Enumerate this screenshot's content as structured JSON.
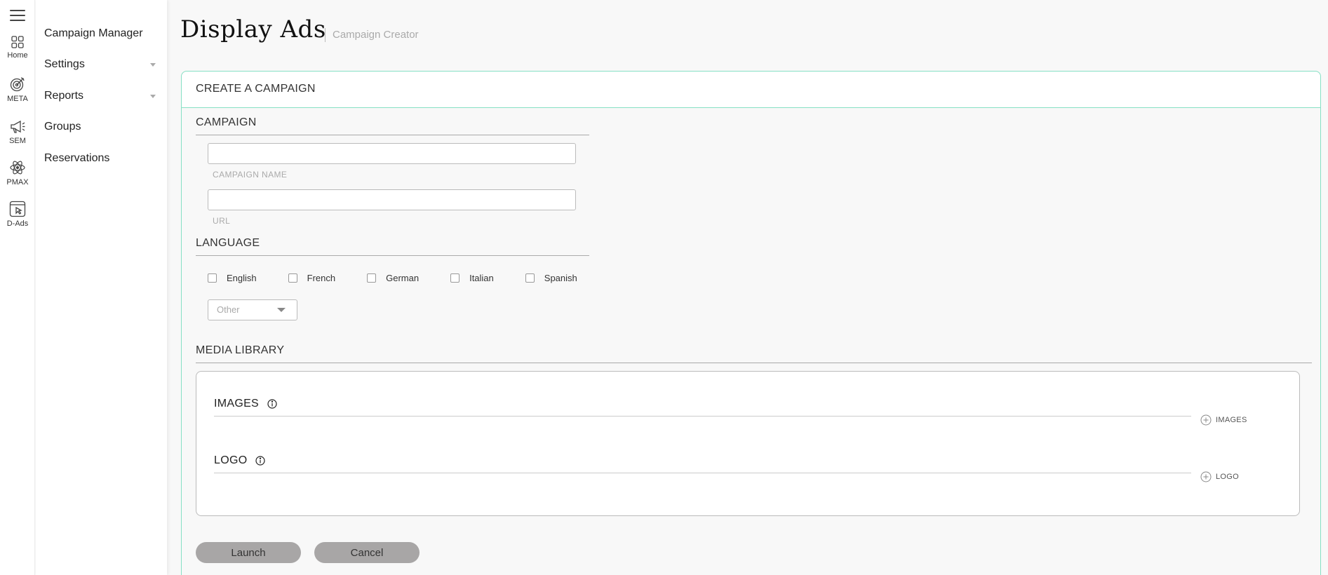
{
  "rail": {
    "items": [
      {
        "label": "Home",
        "icon": "grid-icon"
      },
      {
        "label": "META",
        "icon": "target-icon"
      },
      {
        "label": "SEM",
        "icon": "megaphone-icon"
      },
      {
        "label": "PMAX",
        "icon": "atom-icon"
      },
      {
        "label": "D-Ads",
        "icon": "display-cursor-icon"
      }
    ]
  },
  "sidebar": {
    "items": [
      {
        "label": "Campaign Manager"
      },
      {
        "label": "Settings"
      },
      {
        "label": "Reports"
      },
      {
        "label": "Groups"
      },
      {
        "label": "Reservations"
      }
    ]
  },
  "header": {
    "title": "Display Ads",
    "subtitle": "Campaign Creator"
  },
  "card": {
    "title": "CREATE A CAMPAIGN",
    "campaign": {
      "section_title": "CAMPAIGN",
      "name_label": "CAMPAIGN NAME",
      "name_value": "",
      "url_label": "URL",
      "url_value": ""
    },
    "language": {
      "section_title": "LANGUAGE",
      "options": [
        "English",
        "French",
        "German",
        "Italian",
        "Spanish"
      ],
      "other_selected": "Other"
    },
    "media": {
      "section_title": "MEDIA LIBRARY",
      "images_title": "IMAGES",
      "images_add": "IMAGES",
      "logo_title": "LOGO",
      "logo_add": "LOGO"
    },
    "actions": {
      "launch": "Launch",
      "cancel": "Cancel"
    }
  },
  "colors": {
    "accent_border": "#86e0c4",
    "button_bg": "#a8a6a6",
    "background": "#f8f8f8"
  }
}
